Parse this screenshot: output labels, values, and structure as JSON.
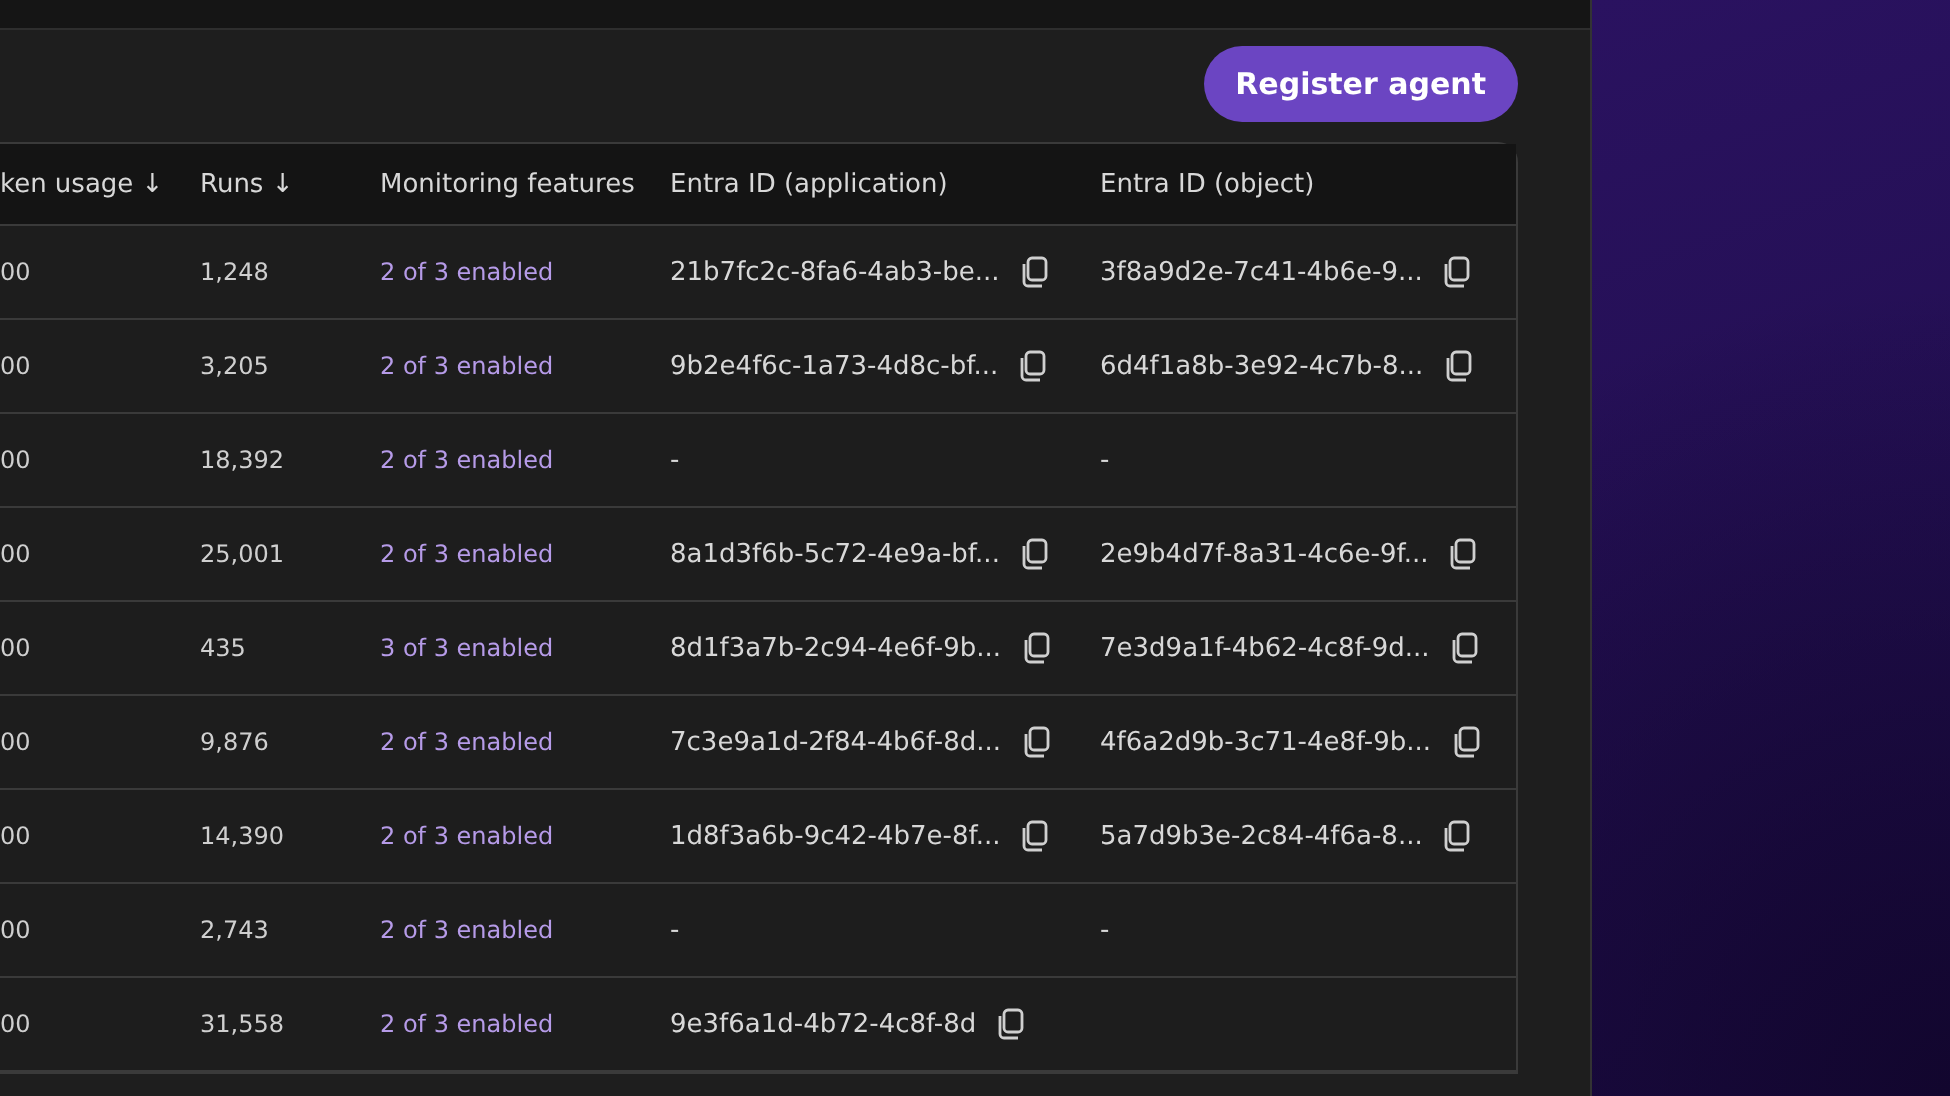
{
  "register_button": {
    "label": "Register agent"
  },
  "table": {
    "columns": [
      "ken usage ↓",
      "Runs ↓",
      "Monitoring features",
      "Entra ID (application)",
      "Entra ID (object)"
    ],
    "rows": [
      {
        "usage": "00",
        "runs": "1,248",
        "monitoring": "2 of 3 enabled",
        "app_id": {
          "text": "21b7fc2c-8fa6-4ab3-be...",
          "copy": true
        },
        "object_id": {
          "text": "3f8a9d2e-7c41-4b6e-9...",
          "copy": true
        }
      },
      {
        "usage": "00",
        "runs": "3,205",
        "monitoring": "2 of 3 enabled",
        "app_id": {
          "text": "9b2e4f6c-1a73-4d8c-bf...",
          "copy": true
        },
        "object_id": {
          "text": "6d4f1a8b-3e92-4c7b-8...",
          "copy": true
        }
      },
      {
        "usage": "00",
        "runs": "18,392",
        "monitoring": "2 of 3 enabled",
        "app_id": {
          "text": "-",
          "copy": false
        },
        "object_id": {
          "text": "-",
          "copy": false
        }
      },
      {
        "usage": "00",
        "runs": "25,001",
        "monitoring": "2 of 3 enabled",
        "app_id": {
          "text": "8a1d3f6b-5c72-4e9a-bf...",
          "copy": true
        },
        "object_id": {
          "text": "2e9b4d7f-8a31-4c6e-9f...",
          "copy": true
        }
      },
      {
        "usage": "00",
        "runs": "435",
        "monitoring": "3 of 3 enabled",
        "app_id": {
          "text": "8d1f3a7b-2c94-4e6f-9b...",
          "copy": true
        },
        "object_id": {
          "text": "7e3d9a1f-4b62-4c8f-9d...",
          "copy": true
        }
      },
      {
        "usage": "00",
        "runs": "9,876",
        "monitoring": "2 of 3 enabled",
        "app_id": {
          "text": "7c3e9a1d-2f84-4b6f-8d...",
          "copy": true
        },
        "object_id": {
          "text": "4f6a2d9b-3c71-4e8f-9b...",
          "copy": true
        }
      },
      {
        "usage": "00",
        "runs": "14,390",
        "monitoring": "2 of 3 enabled",
        "app_id": {
          "text": "1d8f3a6b-9c42-4b7e-8f...",
          "copy": true
        },
        "object_id": {
          "text": "5a7d9b3e-2c84-4f6a-8...",
          "copy": true
        }
      },
      {
        "usage": "00",
        "runs": "2,743",
        "monitoring": "2 of 3 enabled",
        "app_id": {
          "text": "-",
          "copy": false
        },
        "object_id": {
          "text": "-",
          "copy": false
        }
      },
      {
        "usage": "00",
        "runs": "31,558",
        "monitoring": "2 of 3 enabled",
        "app_id": {
          "text": "9e3f6a1d-4b72-4c8f-8d",
          "copy": true
        }
      }
    ]
  }
}
